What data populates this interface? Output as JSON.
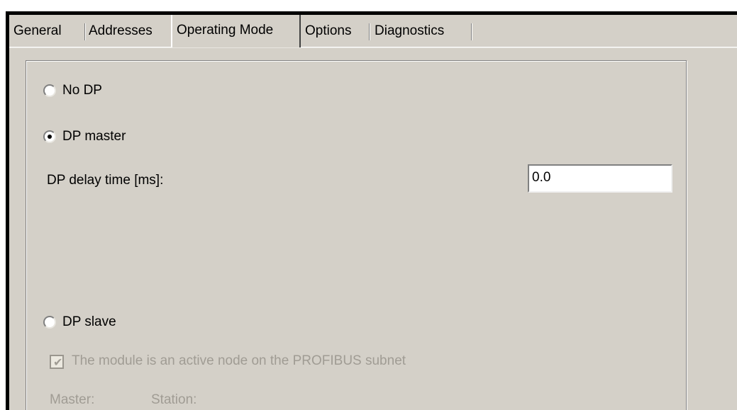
{
  "tabs": [
    {
      "label": "General"
    },
    {
      "label": "Addresses"
    },
    {
      "label": "Operating Mode"
    },
    {
      "label": "Options"
    },
    {
      "label": "Diagnostics"
    }
  ],
  "active_tab": "Operating Mode",
  "operating_mode": {
    "options": {
      "no_dp": {
        "label": "No DP",
        "selected": false
      },
      "dp_master": {
        "label": "DP master",
        "selected": true
      },
      "dp_slave": {
        "label": "DP slave",
        "selected": false
      }
    },
    "dp_delay_label": "DP delay time [ms]:",
    "dp_delay_value": "0.0",
    "active_node_checkbox": {
      "label": "The module is an active node on the PROFIBUS subnet",
      "checked": true,
      "enabled": false
    },
    "master_label": "Master:",
    "station_label": "Station:"
  }
}
